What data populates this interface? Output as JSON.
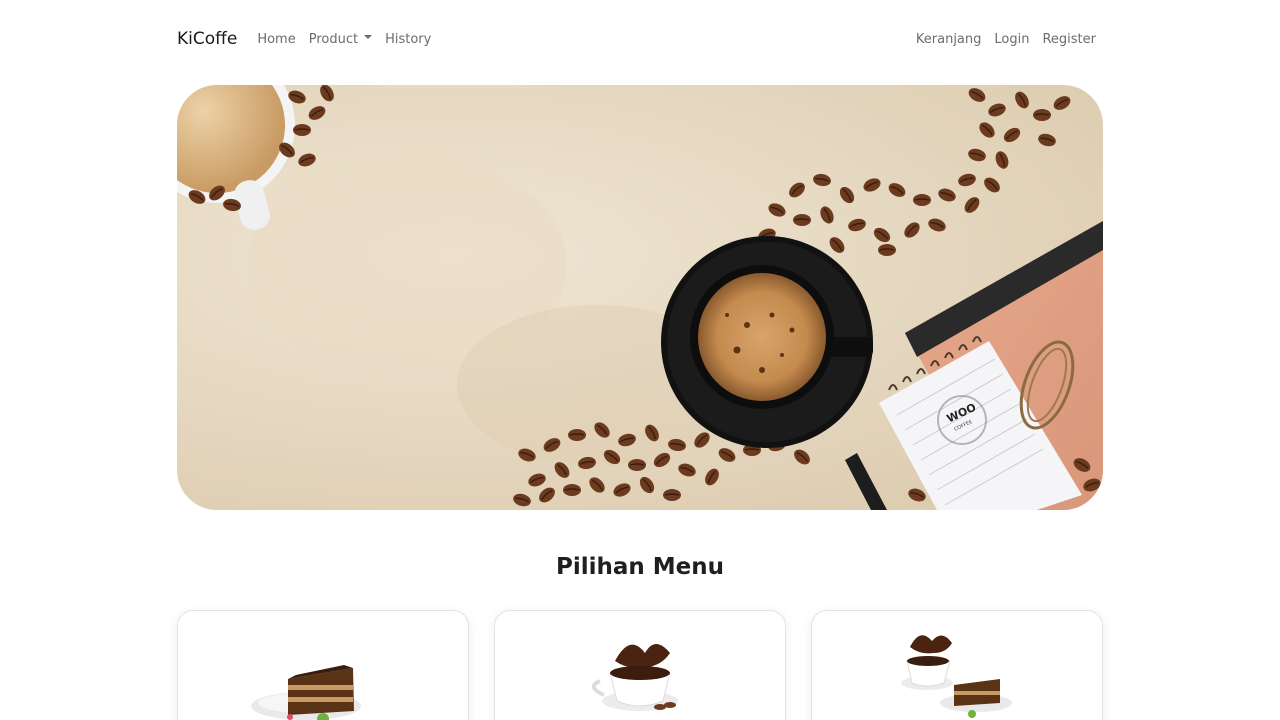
{
  "navbar": {
    "brand": "KiCoffe",
    "links": [
      "Home",
      "Product",
      "History"
    ],
    "right_links": [
      "Keranjang",
      "Login",
      "Register"
    ]
  },
  "hero": {
    "logo_text": "WOO",
    "logo_subtext": "COFFEE"
  },
  "menu_section": {
    "title": "Pilihan Menu"
  },
  "colors": {
    "text_dark": "#1a1a1a",
    "nav_text": "#6c6c6c",
    "hero_bg": "#e6d9c2",
    "bean": "#6b3a1f"
  }
}
